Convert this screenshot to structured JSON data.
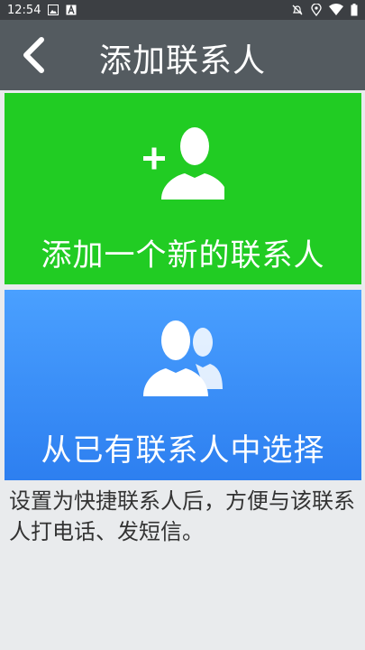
{
  "status_bar": {
    "time": "12:54",
    "left_icons": [
      "photo-icon",
      "a-icon"
    ],
    "right_icons": [
      "silent-icon",
      "location-icon",
      "wifi-icon",
      "battery-icon"
    ]
  },
  "app_bar": {
    "title": "添加联系人",
    "back_icon": "chevron-left-icon"
  },
  "cards": {
    "add_new": {
      "label": "添加一个新的联系人",
      "icon": "add-user-icon",
      "color": "#21CC23"
    },
    "choose_existing": {
      "label": "从已有联系人中选择",
      "icon": "users-icon",
      "color": "#3D8EF8"
    }
  },
  "description": "设置为快捷联系人后，方便与该联系人打电话、发短信。",
  "colors": {
    "status_bar": "#3C3F43",
    "app_bar": "#545B60",
    "background": "#E9EBED"
  }
}
